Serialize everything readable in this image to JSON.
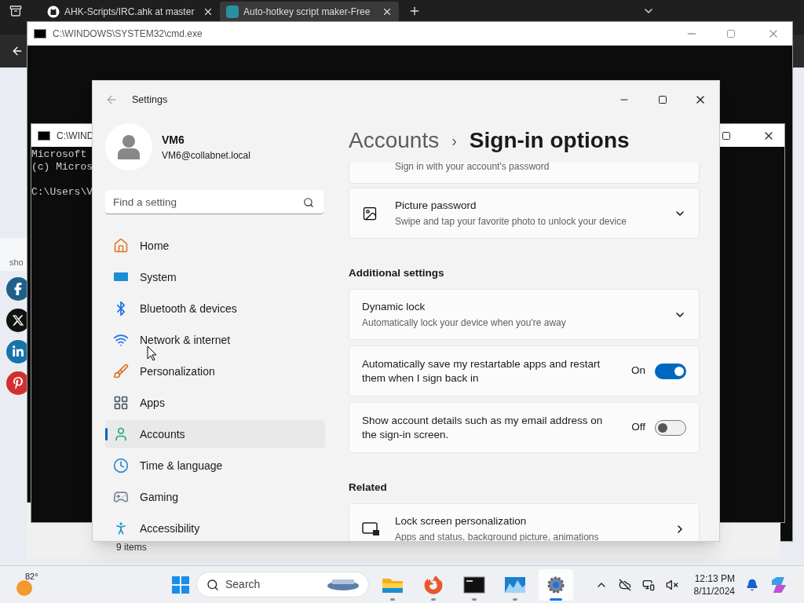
{
  "browser": {
    "tabs": [
      {
        "label": "AHK-Scripts/IRC.ahk at master",
        "kind": "github",
        "selected": false
      },
      {
        "label": "Auto-hotkey script maker-Free",
        "kind": "ai",
        "selected": true
      }
    ]
  },
  "share_bar": {
    "label": "sho",
    "buttons": [
      {
        "kind": "facebook",
        "color": "#1f5f8b"
      },
      {
        "kind": "x",
        "color": "#111111"
      },
      {
        "kind": "linkedin",
        "color": "#1a73a8"
      },
      {
        "kind": "pinterest",
        "color": "#d32f2f"
      }
    ]
  },
  "cmd_back": {
    "title": "C:\\WINDOWS\\SYSTEM32\\cmd.exe"
  },
  "cmd_front": {
    "title": "C:\\WIND",
    "lines": [
      "Microsoft",
      "(c) Micros"
    ],
    "prompt": "C:\\Users\\V"
  },
  "explorer": {
    "status": "9 items"
  },
  "settings": {
    "title": "Settings",
    "user": {
      "name": "VM6",
      "email": "VM6@collabnet.local"
    },
    "search": {
      "placeholder": "Find a setting"
    },
    "nav": [
      {
        "label": "Home",
        "kind": "home",
        "selected": false
      },
      {
        "label": "System",
        "kind": "system",
        "selected": false
      },
      {
        "label": "Bluetooth & devices",
        "kind": "bluetooth",
        "selected": false
      },
      {
        "label": "Network & internet",
        "kind": "network",
        "selected": false
      },
      {
        "label": "Personalization",
        "kind": "personalization",
        "selected": false
      },
      {
        "label": "Apps",
        "kind": "apps",
        "selected": false
      },
      {
        "label": "Accounts",
        "kind": "accounts",
        "selected": true
      },
      {
        "label": "Time & language",
        "kind": "time",
        "selected": false
      },
      {
        "label": "Gaming",
        "kind": "gaming",
        "selected": false
      },
      {
        "label": "Accessibility",
        "kind": "accessibility",
        "selected": false
      }
    ],
    "breadcrumb": {
      "parent": "Accounts",
      "separator": "›",
      "current": "Sign-in options"
    },
    "sections": [
      {
        "cards": [
          {
            "kind": "partial",
            "subtitle": "Sign in with your account's password"
          },
          {
            "kind": "picture",
            "title": "Picture password",
            "subtitle": "Swipe and tap your favorite photo to unlock your device"
          }
        ]
      },
      {
        "heading": "Additional settings",
        "cards": [
          {
            "kind": "expand",
            "title": "Dynamic lock",
            "subtitle": "Automatically lock your device when you're away"
          },
          {
            "kind": "toggle",
            "title": "Automatically save my restartable apps and restart them when I sign back in",
            "reading": "On",
            "on": true
          },
          {
            "kind": "toggle",
            "title": "Show account details such as my email address on the sign-in screen.",
            "reading": "Off",
            "on": false
          }
        ]
      },
      {
        "heading": "Related",
        "cards": [
          {
            "kind": "link",
            "title": "Lock screen personalization",
            "subtitle": "Apps and status, background picture, animations"
          }
        ]
      }
    ]
  },
  "taskbar": {
    "weather": "82°",
    "search": "Search",
    "apps": [
      {
        "kind": "folder",
        "selected": false
      },
      {
        "kind": "firefox",
        "selected": false
      },
      {
        "kind": "terminal",
        "selected": false
      },
      {
        "kind": "photos",
        "selected": false
      },
      {
        "kind": "settings",
        "selected": true
      }
    ],
    "time": "12:13 PM",
    "date": "8/11/2024"
  }
}
